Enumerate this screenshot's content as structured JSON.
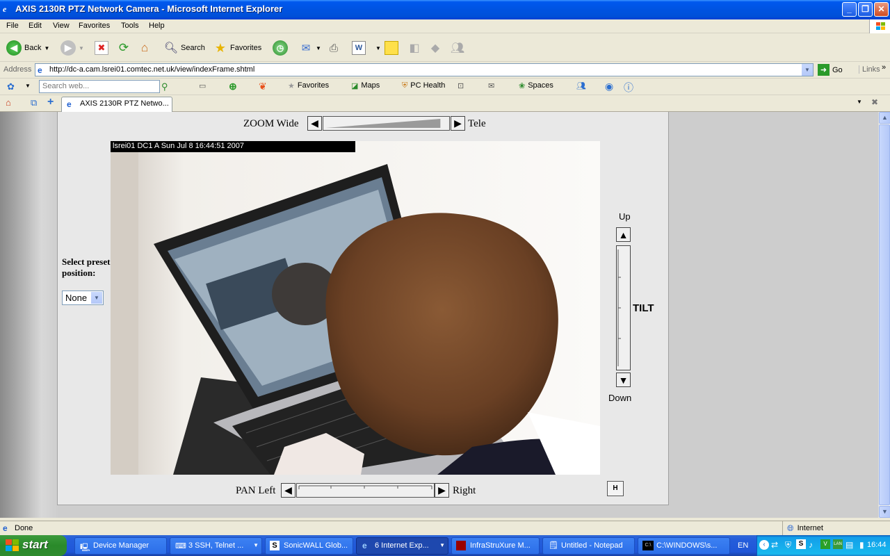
{
  "window": {
    "title": "AXIS 2130R PTZ Network Camera - Microsoft Internet Explorer",
    "min": "_",
    "max": "❐",
    "close": "✕"
  },
  "menu": [
    "File",
    "Edit",
    "View",
    "Favorites",
    "Tools",
    "Help"
  ],
  "toolbar": {
    "back": "Back",
    "search": "Search",
    "favorites": "Favorites"
  },
  "address": {
    "label": "Address",
    "url": "http://dc-a.cam.lsrei01.comtec.net.uk/view/indexFrame.shtml",
    "go": "Go",
    "links": "Links"
  },
  "live": {
    "search_placeholder": "Search web...",
    "favorites": "Favorites",
    "maps": "Maps",
    "pc_health": "PC Health",
    "spaces": "Spaces"
  },
  "tab": {
    "label": "AXIS 2130R PTZ Netwo..."
  },
  "camera": {
    "zoom_label": "ZOOM Wide",
    "tele_label": "Tele",
    "overlay": "lsrei01  DC1  A   Sun Jul  8  16:44:51  2007",
    "preset_label": "Select preset position:",
    "preset_value": "None",
    "up_label": "Up",
    "down_label": "Down",
    "tilt_label": "TILT",
    "pan_label": "PAN Left",
    "right_label": "Right",
    "home_btn": "H",
    "zoom_level": 0.95,
    "pan_position": 0.5
  },
  "status": {
    "text": "Done",
    "zone": "Internet"
  },
  "taskbar": {
    "start": "start",
    "tasks": [
      "Device Manager",
      "3 SSH, Telnet ...",
      "SonicWALL Glob...",
      "6 Internet Exp...",
      "InfraStruXure M...",
      "Untitled - Notepad",
      "C:\\WINDOWS\\s..."
    ],
    "lang": "EN",
    "clock": "16:44"
  }
}
